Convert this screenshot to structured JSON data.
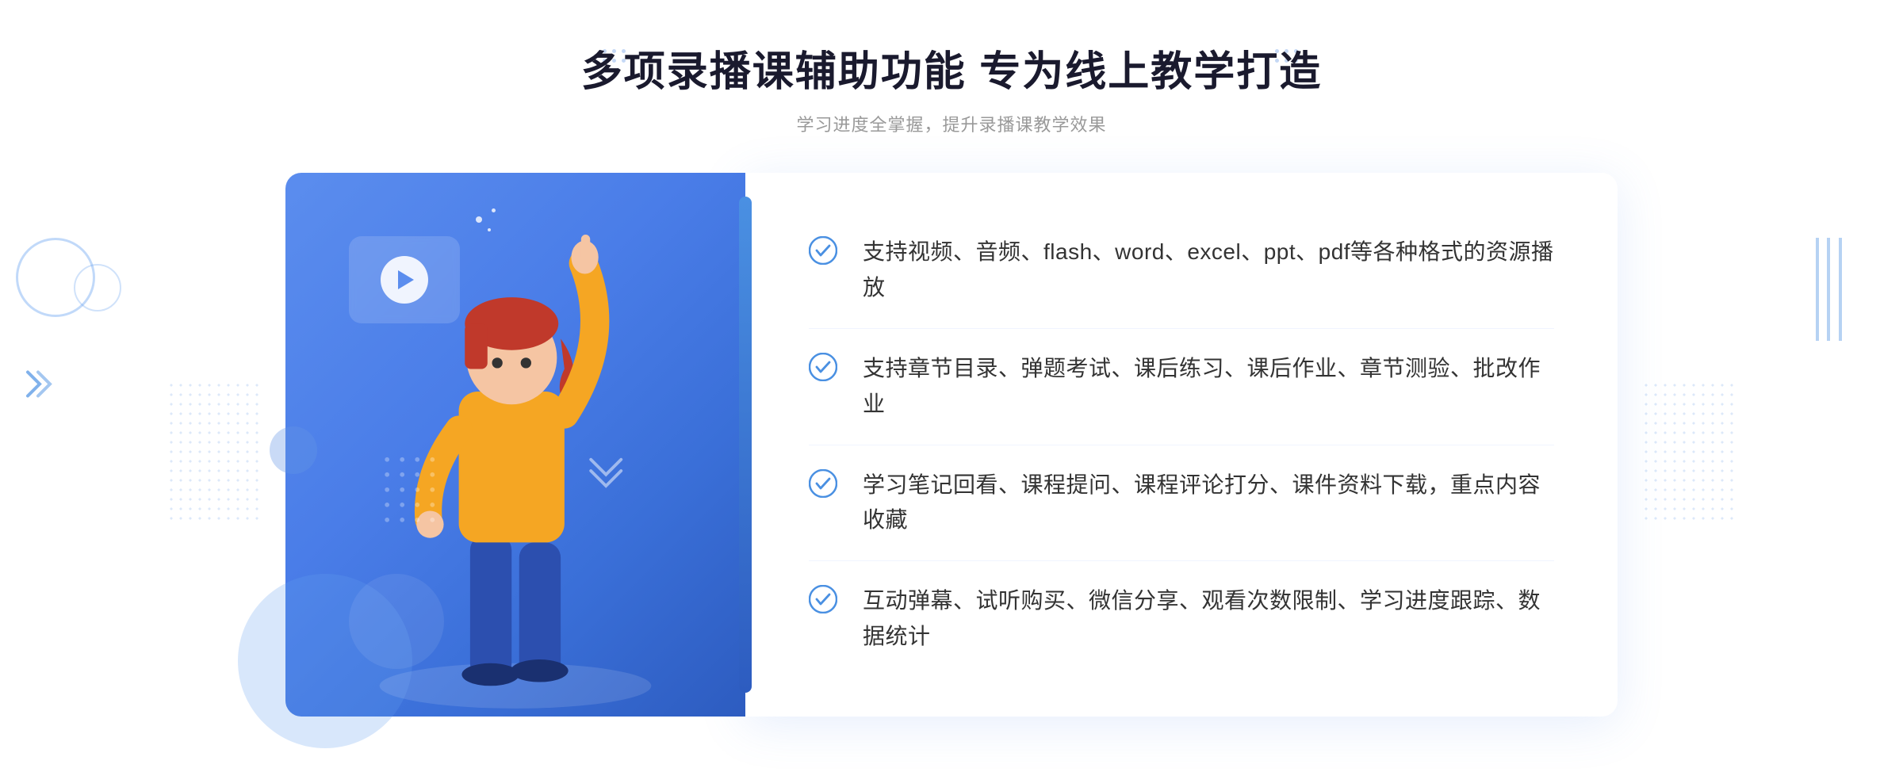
{
  "header": {
    "main_title": "多项录播课辅助功能 专为线上教学打造",
    "sub_title": "学习进度全掌握，提升录播课教学效果"
  },
  "features": [
    {
      "id": 1,
      "text": "支持视频、音频、flash、word、excel、ppt、pdf等各种格式的资源播放"
    },
    {
      "id": 2,
      "text": "支持章节目录、弹题考试、课后练习、课后作业、章节测验、批改作业"
    },
    {
      "id": 3,
      "text": "学习笔记回看、课程提问、课程评论打分、课件资料下载，重点内容收藏"
    },
    {
      "id": 4,
      "text": "互动弹幕、试听购买、微信分享、观看次数限制、学习进度跟踪、数据统计"
    }
  ],
  "colors": {
    "primary_blue": "#5b8dee",
    "dark_blue": "#2d5cc0",
    "text_dark": "#1a1a2e",
    "text_light": "#999999",
    "text_body": "#333333",
    "accent": "#4a90e2"
  }
}
